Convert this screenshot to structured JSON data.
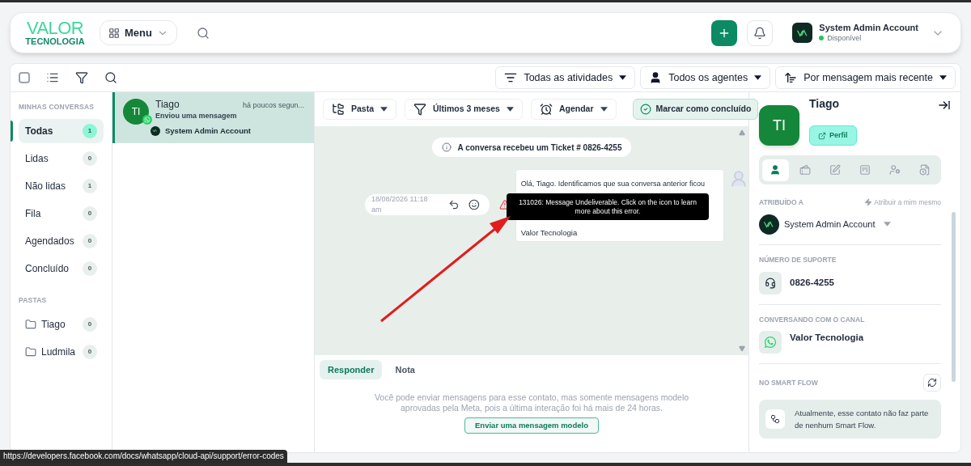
{
  "header": {
    "logo": {
      "line1": "VALOR",
      "line2": "TECNOLOGIA"
    },
    "menu_button": "Menu",
    "user": {
      "name": "System Admin Account",
      "status": "Disponível",
      "online": true
    }
  },
  "toolbar": {
    "select_all": {
      "checked": false
    },
    "filters": [
      {
        "kind": "activity",
        "label": "Todas as atividades"
      },
      {
        "kind": "agent",
        "label": "Todos os agentes"
      },
      {
        "kind": "sort",
        "label": "Por mensagem mais recente"
      }
    ]
  },
  "sidebar": {
    "sections": [
      {
        "title": "MINHAS CONVERSAS",
        "items": [
          {
            "kind": "view",
            "label": "Todas",
            "count": "1",
            "selected": true
          },
          {
            "kind": "view",
            "label": "Lidas",
            "count": "0",
            "selected": false
          },
          {
            "kind": "view",
            "label": "Não lidas",
            "count": "1",
            "selected": false
          },
          {
            "kind": "view",
            "label": "Fila",
            "count": "0",
            "selected": false
          },
          {
            "kind": "view",
            "label": "Agendados",
            "count": "0",
            "selected": false
          },
          {
            "kind": "view",
            "label": "Concluído",
            "count": "0",
            "selected": false
          }
        ]
      },
      {
        "title": "PASTAS",
        "items": [
          {
            "kind": "folder",
            "label": "Tiago",
            "count": "0",
            "selected": false
          },
          {
            "kind": "folder",
            "label": "Ludmila",
            "count": "0",
            "selected": false
          }
        ]
      }
    ]
  },
  "conversations": [
    {
      "initials": "TI",
      "name": "Tiago",
      "preview": "Enviou uma mensagem",
      "time": "há poucos segun...",
      "agent": "System Admin Account",
      "selected": true
    }
  ],
  "chat": {
    "toolbar": [
      {
        "kind": "folder",
        "label": "Pasta"
      },
      {
        "kind": "period",
        "label": "Últimos 3 meses"
      },
      {
        "kind": "schedule",
        "label": "Agendar"
      }
    ],
    "done_button": "Marcar como concluído",
    "ticket_notice": "A conversa recebeu um Ticket # 0826-4255",
    "message": {
      "text": "Olá, Tiago. Identificamos que sua conversa anterior ficou",
      "signature": "Valor Tecnologia",
      "time": "18/08/2026 11:18 am",
      "failed": true
    },
    "tooltip": "131026: Message Undeliverable. Click on the icon to learn more about this error.",
    "compose_tabs": [
      {
        "label": "Responder",
        "selected": true
      },
      {
        "label": "Nota",
        "selected": false
      }
    ],
    "notice": "Você pode enviar mensagens para esse contato, mas somente mensagens modelo aprovadas pela Meta, pois a última interação foi há mais de 24 horas.",
    "template_button": "Enviar uma mensagem modelo"
  },
  "contact": {
    "initials": "TI",
    "name": "Tiago",
    "profile_button": "Perfil",
    "tabs": [
      {
        "kind": "contact",
        "selected": true
      },
      {
        "kind": "tickets",
        "selected": false
      },
      {
        "kind": "notes",
        "selected": false
      },
      {
        "kind": "board",
        "selected": false
      },
      {
        "kind": "agents",
        "selected": false
      },
      {
        "kind": "history",
        "selected": false
      }
    ],
    "assigned": {
      "title": "ATRIBUÍDO A",
      "action": "Atribuir a mim mesmo",
      "agent": "System Admin Account"
    },
    "support": {
      "title": "NÚMERO DE SUPORTE",
      "value": "0826-4255"
    },
    "channel": {
      "title": "CONVERSANDO COM O CANAL",
      "value": "Valor Tecnologia"
    },
    "smart_flow": {
      "title": "NO SMART FLOW",
      "text": "Atualmente, esse contato não faz parte de nenhum Smart Flow."
    }
  },
  "status_url": "https://developers.facebook.com/docs/whatsapp/cloud-api/support/error-codes"
}
